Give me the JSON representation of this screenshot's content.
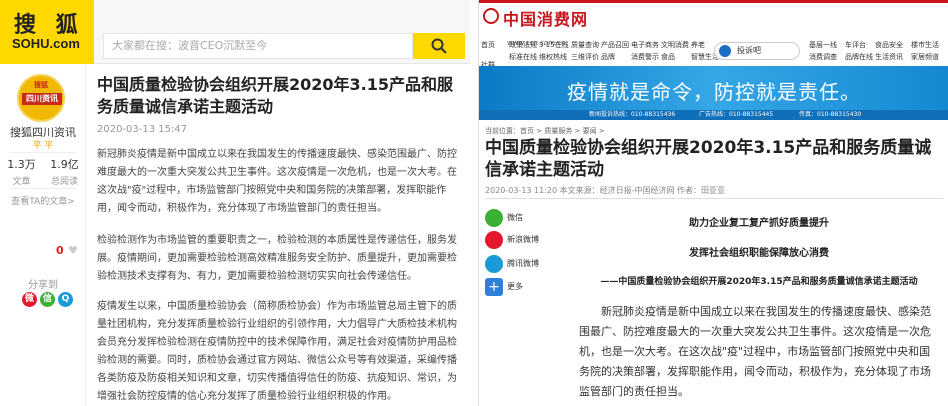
{
  "sohu": {
    "logo_cn": "搜 狐",
    "logo_en": "SOHU.com",
    "search_placeholder": "大家都在搜：波音CEO沉默至今",
    "author": {
      "avatar_top": "搜狐",
      "avatar_badge": "四川资讯",
      "name": "搜狐四川资讯",
      "mark": "平 平",
      "stats": [
        {
          "num": "1.3万",
          "label": "文章"
        },
        {
          "num": "1.9亿",
          "label": "总阅读"
        }
      ],
      "more": "查看TA的文章>"
    },
    "like_count": "0",
    "share_label": "分享到",
    "title": "中国质量检验协会组织开展2020年3.15产品和服务质量诚信承诺主题活动",
    "date": "2020-03-13 15:47",
    "paragraphs": [
      "新冠肺炎疫情是新中国成立以来在我国发生的传播速度最快、感染范围最广、防控难度最大的一次重大突发公共卫生事件。这次疫情是一次危机，也是一次大考。在这次战\"疫\"过程中，市场监管部门按照党中央和国务院的决策部署，发挥职能作用，闻令而动，积极作为，充分体现了市场监管部门的责任担当。",
      "检验检测作为市场监管的重要职责之一，检验检测的本质属性是传递信任，服务发展。疫情期间，更加需要检验检测高效精准服务安全防护、质量提升，更加需要检验检测技术支撑有为、有力，更加需要检验检测切实实向社会传递信任。",
      "疫情发生以来，中国质量检验协会（简称质检协会）作为市场监管总局主管下的质量社团机构，充分发挥质量检验行业组织的引领作用，大力倡导广大质检技术机构会员充分发挥检验检测在疫情防控中的技术保障作用，满足社会对疫情防护用品检验检测的需要。同时，质检协会通过官方网站、微信公众号等有效渠道，采编传播各类防疫及防疫相关知识和文章，切实传播值得信任的防疫、抗疫知识、常识，为增强社会防控疫情的信心充分发挥了质量检验行业组织积极的作用。"
    ]
  },
  "ccn": {
    "logo_cn": "中国消费网",
    "logo_url": "www.ccn.com.cn",
    "left_nav": [
      "首页",
      "社群"
    ],
    "nav": [
      "政策法规",
      "3·15在线",
      "质量查询",
      "产品召回",
      "电子商务",
      "文明消费",
      "养老",
      "标准在线",
      "维权热线",
      "三维评价",
      "品牌",
      "消费警示",
      "食品",
      "智慧生活",
      "基层一线",
      "车评台",
      "食品安全",
      "楼市生活",
      "消费调查",
      "品牌在线",
      "生活资讯",
      "家居频道"
    ],
    "complaint_btn": "投诉吧",
    "banner_text": "疫情就是命令，防控就是责任。",
    "hotline": [
      "新闻投诉热线：010-88315436",
      "广告热线：010-88315445",
      "传真：010-88315430"
    ],
    "breadcrumb": "当前位置：首页 > 质量服务 > 要闻 >",
    "title": "中国质量检验协会组织开展2020年3.15产品和服务质量诚信承诺主题活动",
    "meta": "2020-03-13 11:20  本文来源：经济日报-中国经济网  作者：田亚亚",
    "share": [
      "微信",
      "新浪微博",
      "腾讯微博",
      "更多"
    ],
    "subheads": [
      "助力企业复工复产抓好质量提升",
      "发挥社会组织职能保障放心消费",
      "——中国质量检验协会组织开展2020年3.15产品和服务质量诚信承诺主题活动"
    ],
    "paragraph": "新冠肺炎疫情是新中国成立以来在我国发生的传播速度最快、感染范围最广、防控难度最大的一次重大突发公共卫生事件。这次疫情是一次危机，也是一次大考。在这次战\"疫\"过程中，市场监管部门按照党中央和国务院的决策部署，发挥职能作用，闻令而动，积极作为，充分体现了市场监管部门的责任担当。"
  },
  "colors": {
    "sohu_yellow": "#ffd800",
    "ccn_red": "#c8161d",
    "ccn_blue": "#0a7ac6",
    "wechat_green": "#3cb034",
    "weibo_red": "#e6162d",
    "tencent_blue": "#1b9ad8"
  }
}
